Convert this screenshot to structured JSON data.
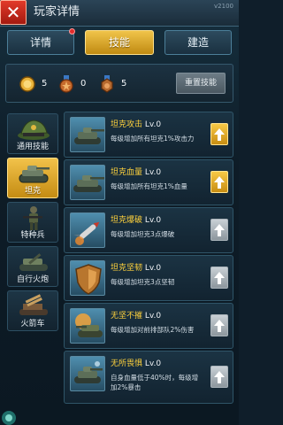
{
  "header": {
    "close_icon": "close-icon",
    "title": "玩家详情",
    "version": "v2100"
  },
  "tabs": [
    {
      "label": "详情",
      "active": false,
      "has_notification": true
    },
    {
      "label": "技能",
      "active": true,
      "has_notification": false
    },
    {
      "label": "建造",
      "active": false,
      "has_notification": false
    }
  ],
  "stats": {
    "medals": [
      {
        "icon": "gold-medal-icon",
        "value": "5"
      },
      {
        "icon": "bronze-star-medal-icon",
        "value": "0"
      },
      {
        "icon": "bronze-medal-icon",
        "value": "5"
      }
    ],
    "reset_label": "重置技能"
  },
  "categories": [
    {
      "label": "通用技能",
      "icon": "officer-cap-icon",
      "active": false
    },
    {
      "label": "坦克",
      "icon": "tank-icon",
      "active": true
    },
    {
      "label": "特种兵",
      "icon": "soldier-icon",
      "active": false
    },
    {
      "label": "自行火炮",
      "icon": "artillery-icon",
      "active": false
    },
    {
      "label": "火箭车",
      "icon": "rocket-launcher-icon",
      "active": false
    }
  ],
  "skills": [
    {
      "name": "坦克攻击",
      "level": "Lv.0",
      "desc": "每级增加所有坦克1%攻击力",
      "icon": "tank-attack-icon",
      "upgradable": true
    },
    {
      "name": "坦克血量",
      "level": "Lv.0",
      "desc": "每级增加所有坦克1%血量",
      "icon": "tank-health-icon",
      "upgradable": true
    },
    {
      "name": "坦克爆破",
      "level": "Lv.0",
      "desc": "每级增加坦克3点爆破",
      "icon": "missile-icon",
      "upgradable": false
    },
    {
      "name": "坦克坚韧",
      "level": "Lv.0",
      "desc": "每级增加坦克3点坚韧",
      "icon": "shield-icon",
      "upgradable": false
    },
    {
      "name": "无坚不摧",
      "level": "Lv.0",
      "desc": "每级增加对前排部队2%伤害",
      "icon": "tank-firing-icon",
      "upgradable": false
    },
    {
      "name": "无所畏惧",
      "level": "Lv.0",
      "desc": "自身血量低于40%时，每级增加2%暴击",
      "icon": "tank-fearless-icon",
      "upgradable": false
    }
  ],
  "colors": {
    "accent_gold": "#f0c44a",
    "name_highlight": "#ffd23c",
    "close_red": "#e23a2a"
  }
}
